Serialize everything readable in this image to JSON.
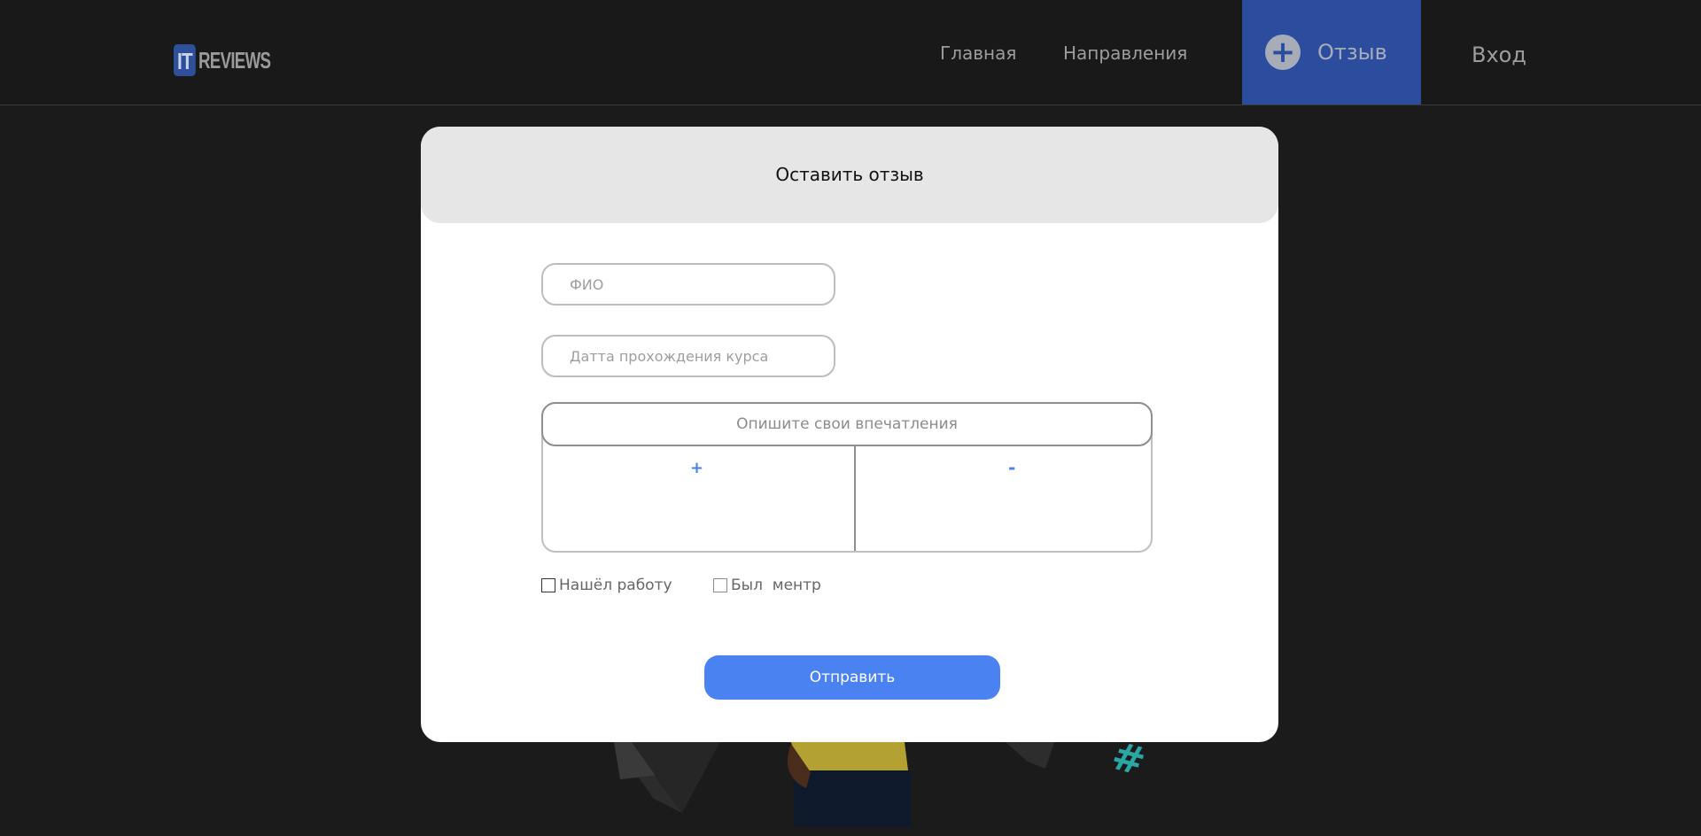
{
  "header": {
    "logo": {
      "part1": "IT",
      "part2": "REVIEWS"
    },
    "nav": {
      "home": "Главная",
      "directions": "Направления",
      "review": "Отзыв",
      "login": "Вход"
    }
  },
  "modal": {
    "title": "Оставить отзыв",
    "fio_placeholder": "ФИО",
    "date_placeholder": "Датта прохождения курса",
    "impressions_label": "Опишите свои впечатления",
    "pros_sign": "+",
    "cons_sign": "-",
    "checkbox_found_job": "Нашёл работу",
    "checkbox_had_mentor": "Был  ментр",
    "submit_label": "Отправить"
  },
  "colors": {
    "background": "#1b1b1b",
    "accent_blue": "#4b82f1",
    "header_button": "#2c4d9e"
  }
}
